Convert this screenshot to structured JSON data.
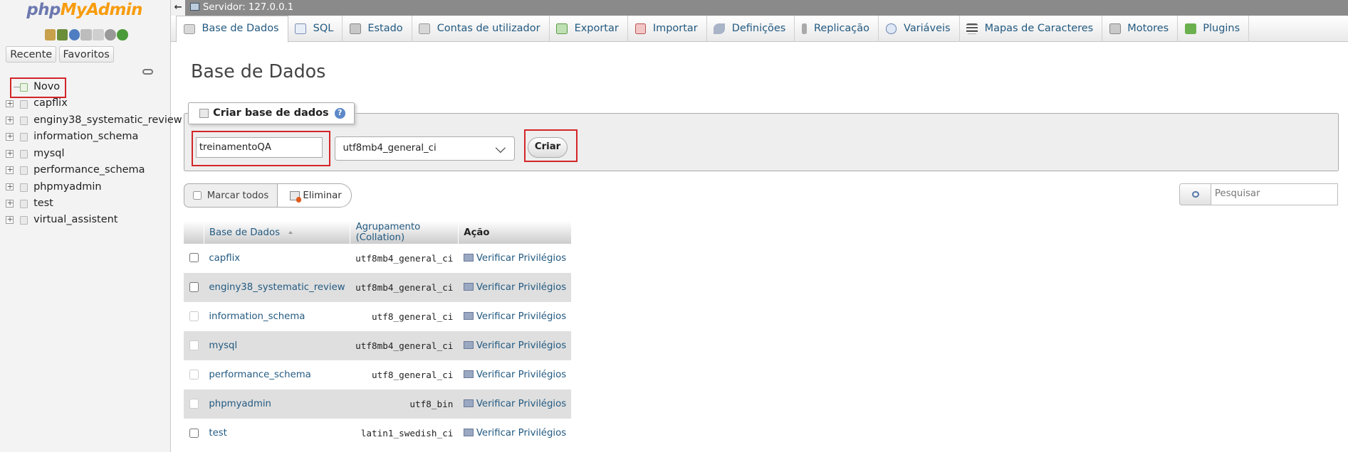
{
  "logo": {
    "part1": "php",
    "part2": "MyAdmin"
  },
  "nav": {
    "tabs": [
      "Recente",
      "Favoritos"
    ],
    "novo": "Novo",
    "databases": [
      "capflix",
      "enginy38_systematic_review",
      "information_schema",
      "mysql",
      "performance_schema",
      "phpmyadmin",
      "test",
      "virtual_assistent"
    ]
  },
  "serverbar": {
    "label": "Servidor: 127.0.0.1"
  },
  "topmenu": [
    {
      "label": "Base de Dados",
      "icon": "database-icon"
    },
    {
      "label": "SQL",
      "icon": "sql-icon"
    },
    {
      "label": "Estado",
      "icon": "status-icon"
    },
    {
      "label": "Contas de utilizador",
      "icon": "users-icon"
    },
    {
      "label": "Exportar",
      "icon": "export-icon"
    },
    {
      "label": "Importar",
      "icon": "import-icon"
    },
    {
      "label": "Definições",
      "icon": "wrench-icon"
    },
    {
      "label": "Replicação",
      "icon": "replication-icon"
    },
    {
      "label": "Variáveis",
      "icon": "variables-icon"
    },
    {
      "label": "Mapas de Caracteres",
      "icon": "charset-icon"
    },
    {
      "label": "Motores",
      "icon": "engines-icon"
    },
    {
      "label": "Plugins",
      "icon": "plugin-icon"
    }
  ],
  "page": {
    "title": "Base de Dados",
    "create_legend": "Criar base de dados",
    "dbname_value": "treinamentoQA",
    "collation_value": "utf8mb4_general_ci",
    "create_button": "Criar",
    "marcar_todos": "Marcar todos",
    "eliminar": "Eliminar",
    "search_placeholder": "Pesquisar"
  },
  "table": {
    "headers": {
      "name": "Base de Dados",
      "collation": "Agrupamento (Collation)",
      "action": "Ação"
    },
    "rows": [
      {
        "name": "capflix",
        "collation": "utf8mb4_general_ci",
        "action": "Verificar Privilégios",
        "disabled": false
      },
      {
        "name": "enginy38_systematic_review",
        "collation": "utf8mb4_general_ci",
        "action": "Verificar Privilégios",
        "disabled": false
      },
      {
        "name": "information_schema",
        "collation": "utf8_general_ci",
        "action": "Verificar Privilégios",
        "disabled": true
      },
      {
        "name": "mysql",
        "collation": "utf8mb4_general_ci",
        "action": "Verificar Privilégios",
        "disabled": true
      },
      {
        "name": "performance_schema",
        "collation": "utf8_general_ci",
        "action": "Verificar Privilégios",
        "disabled": true
      },
      {
        "name": "phpmyadmin",
        "collation": "utf8_bin",
        "action": "Verificar Privilégios",
        "disabled": true
      },
      {
        "name": "test",
        "collation": "latin1_swedish_ci",
        "action": "Verificar Privilégios",
        "disabled": false
      }
    ]
  },
  "colors": {
    "link": "#235a81",
    "highlight": "#d42528",
    "logo_php": "#6c78af",
    "logo_myadmin": "#f89c0e"
  }
}
